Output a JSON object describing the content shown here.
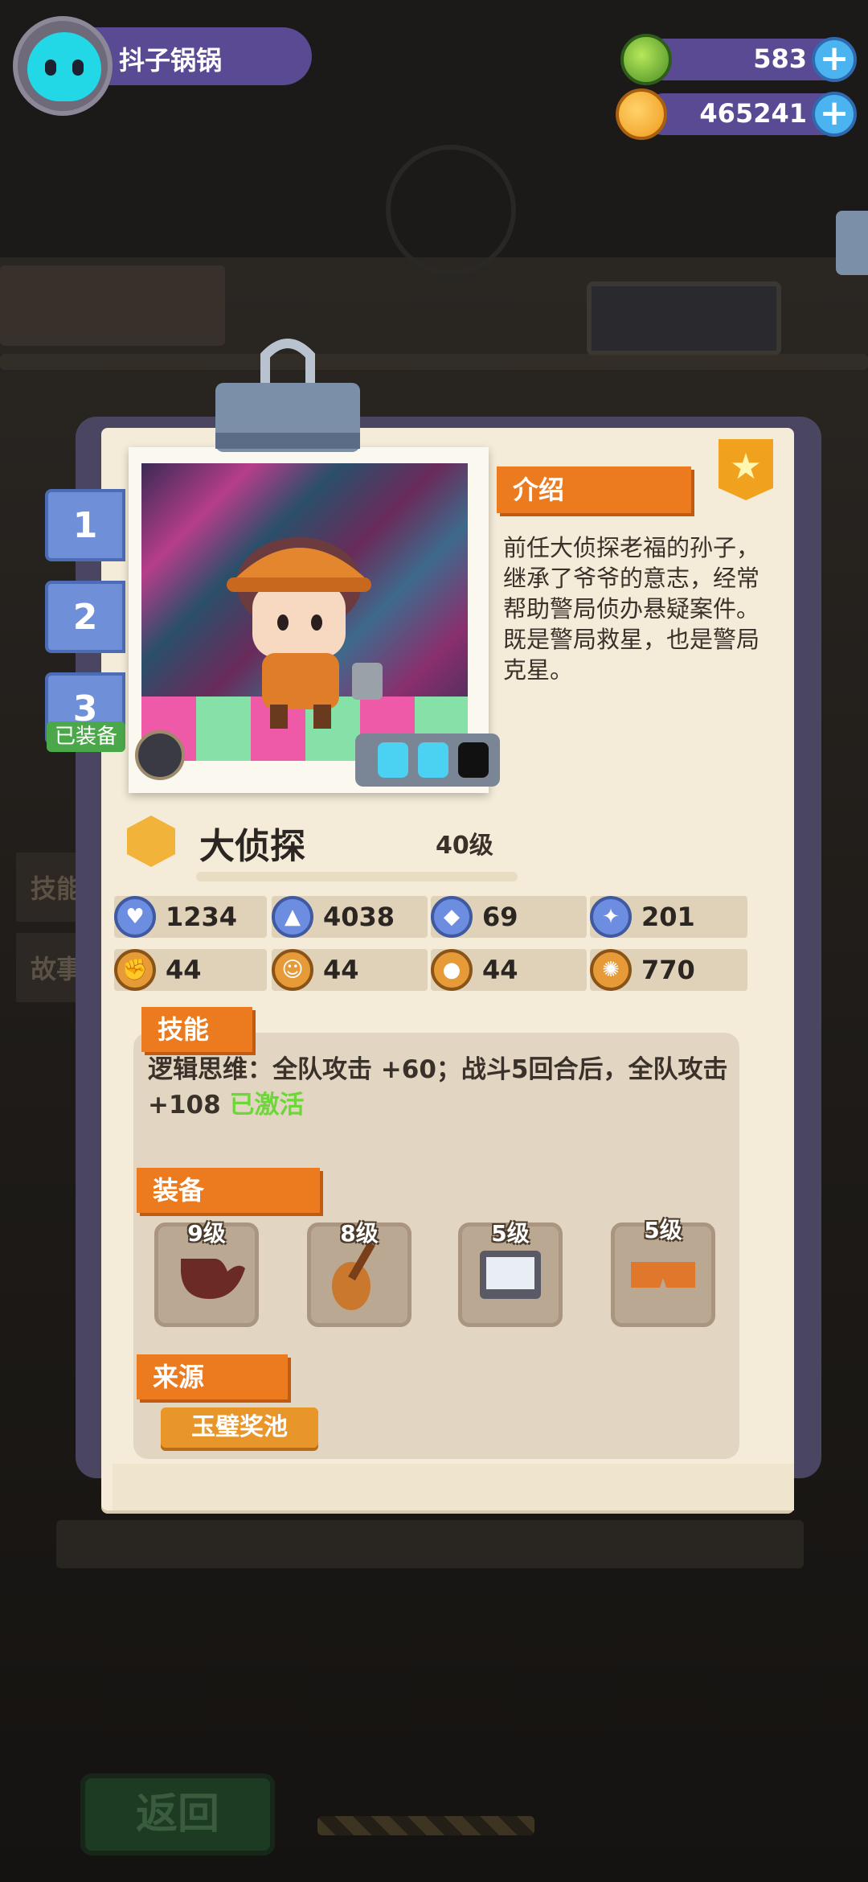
{
  "player": {
    "name": "抖子锅锅"
  },
  "currencies": [
    {
      "type": "gem",
      "amount": "583"
    },
    {
      "type": "coin",
      "amount": "465241"
    }
  ],
  "outfit_tabs": [
    {
      "label": "1"
    },
    {
      "label": "2"
    },
    {
      "label": "3",
      "badge": "已装备"
    }
  ],
  "card": {
    "intro_title": "介绍",
    "intro_text": "前任大侦探老福的孙子，继承了爷爷的意志，经常帮助警局侦办悬疑案件。既是警局救星，也是警局克星。",
    "name": "大侦探",
    "level": "40级",
    "stats": [
      {
        "icon": "heart-shield-icon",
        "value": "1234"
      },
      {
        "icon": "attack-icon",
        "value": "4038"
      },
      {
        "icon": "defense-icon",
        "value": "69"
      },
      {
        "icon": "speed-icon",
        "value": "201"
      },
      {
        "icon": "fist-icon",
        "value": "44"
      },
      {
        "icon": "smile-icon",
        "value": "44"
      },
      {
        "icon": "muscle-icon",
        "value": "44"
      },
      {
        "icon": "brain-icon",
        "value": "770"
      }
    ],
    "skill_title": "技能",
    "skill_text": "逻辑思维：全队攻击 +60；战斗5回合后，全队攻击 +108",
    "skill_status": "已激活",
    "equip_title": "装备",
    "equipment": [
      {
        "item": "pipe-icon",
        "level": "9级"
      },
      {
        "item": "violin-icon",
        "level": "8级"
      },
      {
        "item": "laptop-icon",
        "level": "5级"
      },
      {
        "item": "shorts-icon",
        "level": "5级"
      }
    ],
    "source_title": "来源",
    "source_button": "玉璧奖池"
  },
  "background": {
    "side_buttons": [
      "技能",
      "故事"
    ],
    "back_button": "返回"
  },
  "colors": {
    "accent_orange": "#ec7a1e",
    "hud_purple": "#5a4a93",
    "plus_blue": "#4bb4f0",
    "active_green": "#6ed63a"
  }
}
